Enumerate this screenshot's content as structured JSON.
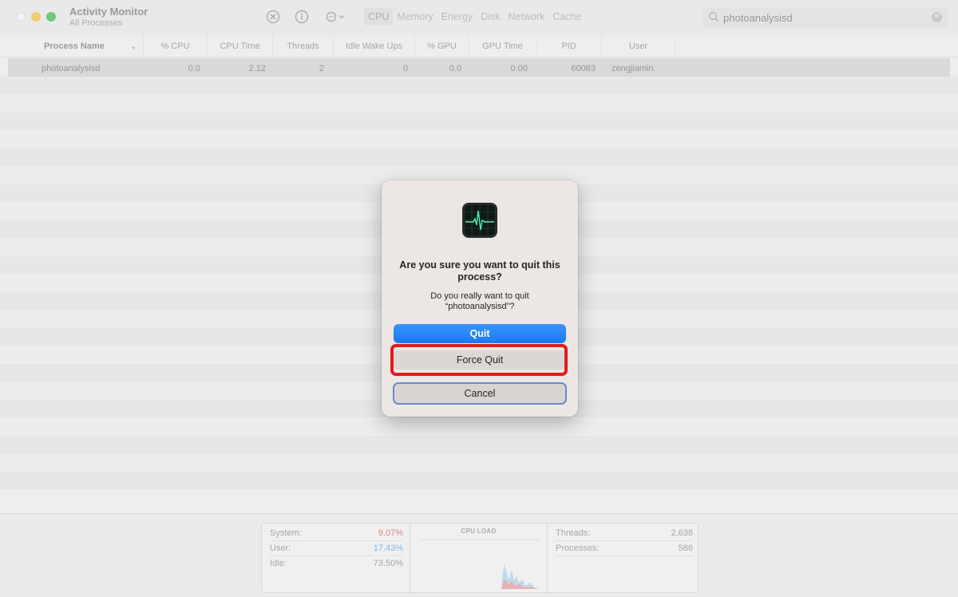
{
  "window": {
    "title": "Activity Monitor",
    "subtitle": "All Processes"
  },
  "toolbar": {
    "stop_icon": "stop-process-icon",
    "info_icon": "info-icon",
    "more_icon": "ellipsis-menu-icon",
    "tabs": [
      {
        "label": "CPU",
        "active": true
      },
      {
        "label": "Memory",
        "active": false
      },
      {
        "label": "Energy",
        "active": false
      },
      {
        "label": "Disk",
        "active": false
      },
      {
        "label": "Network",
        "active": false
      },
      {
        "label": "Cache",
        "active": false
      }
    ],
    "search_value": "photoanalysisd"
  },
  "table": {
    "columns": [
      "Process Name",
      "% CPU",
      "CPU Time",
      "Threads",
      "Idle Wake Ups",
      "% GPU",
      "GPU Time",
      "PID",
      "User"
    ],
    "rows": [
      {
        "process_name": "photoanalysisd",
        "cpu": "0.0",
        "cpu_time": "2.12",
        "threads": "2",
        "idle_wake_ups": "0",
        "gpu": "0.0",
        "gpu_time": "0.00",
        "pid": "60083",
        "user": "zengjiamin"
      }
    ]
  },
  "stats": {
    "system_label": "System:",
    "system_value": "9.07%",
    "user_label": "User:",
    "user_value": "17.43%",
    "idle_label": "Idle:",
    "idle_value": "73.50%",
    "cpu_load_title": "CPU LOAD",
    "threads_label": "Threads:",
    "threads_value": "2,638",
    "processes_label": "Processes:",
    "processes_value": "586",
    "system_color": "#e07070",
    "user_color": "#6aaee8"
  },
  "dialog": {
    "icon": "activity-monitor-app-icon",
    "title": "Are you sure you want to quit this process?",
    "message": "Do you really want to quit “photoanalysisd”?",
    "quit_label": "Quit",
    "force_quit_label": "Force Quit",
    "cancel_label": "Cancel",
    "highlight_color": "#e21b1b"
  }
}
